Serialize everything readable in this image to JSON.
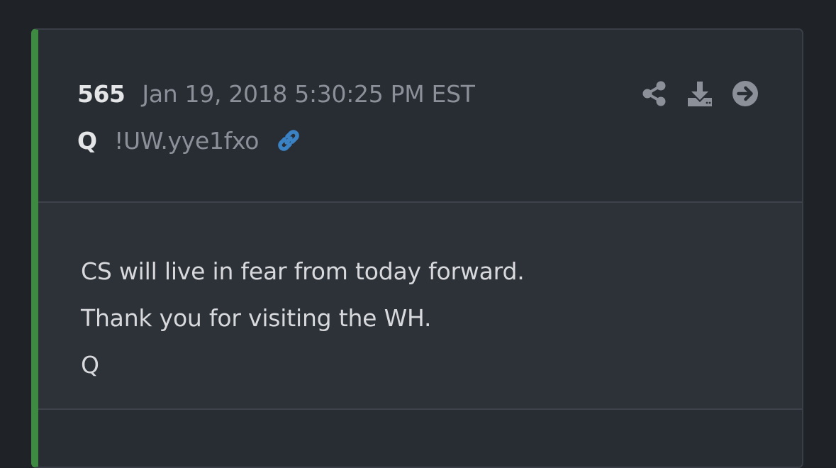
{
  "post": {
    "number": "565",
    "timestamp": "Jan 19, 2018 5:30:25 PM EST",
    "author": "Q",
    "tripcode": "!UW.yye1fxo",
    "body_lines": [
      "CS will live in fear from today forward.",
      "Thank you for visiting the WH.",
      "Q"
    ]
  },
  "icons": {
    "link": "link-icon",
    "share": "share-icon",
    "download": "download-icon",
    "open": "arrow-circle-right-icon"
  },
  "colors": {
    "accent_bar": "#3e8a42",
    "link_icon": "#3b82c4",
    "muted_icon": "#8b9099"
  }
}
